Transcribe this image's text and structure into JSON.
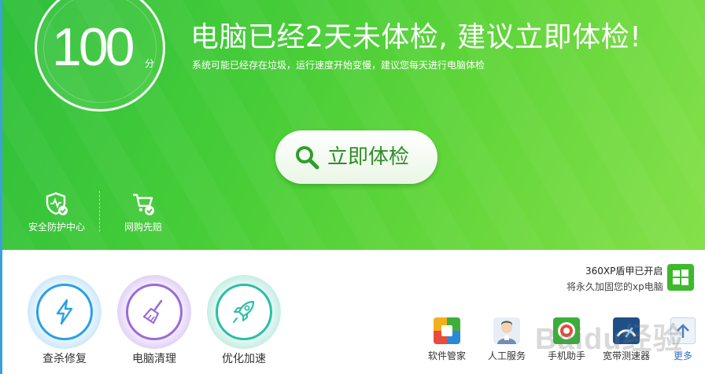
{
  "score": {
    "value": "100",
    "unit": "分"
  },
  "headline": "电脑已经2天未体检, 建议立即体检!",
  "subline": "系统可能已经存在垃圾，运行速度开始变慢，建议您每天进行电脑体检",
  "check_button": {
    "label": "立即体检",
    "icon": "search-icon"
  },
  "hero_tools": [
    {
      "label": "安全防护中心",
      "icon": "shield-check-icon"
    },
    {
      "label": "网购先赔",
      "icon": "shopping-cart-check-icon"
    }
  ],
  "main_tools": [
    {
      "label": "查杀修复",
      "icon": "lightning-icon",
      "color": "#2aa0e8"
    },
    {
      "label": "电脑清理",
      "icon": "broom-icon",
      "color": "#9b6bd8"
    },
    {
      "label": "优化加速",
      "icon": "rocket-icon",
      "color": "#2bbfa6"
    }
  ],
  "xp_shield": {
    "title": "360XP盾甲已开启",
    "subtitle": "将永久加固您的xp电脑",
    "icon": "windows-shield-icon"
  },
  "apps": [
    {
      "label": "软件管家",
      "icon": "software-manager-icon"
    },
    {
      "label": "人工服务",
      "icon": "support-agent-icon"
    },
    {
      "label": "手机助手",
      "icon": "phone-assistant-icon"
    },
    {
      "label": "宽带测速器",
      "icon": "speedtest-icon"
    }
  ],
  "more": {
    "label": "更多",
    "icon": "arrow-up-icon"
  },
  "watermark": "Baidu经验",
  "colors": {
    "hero_green": "#45cc38",
    "accent_text": "#2f8f26",
    "link_blue": "#2f6fc8"
  }
}
